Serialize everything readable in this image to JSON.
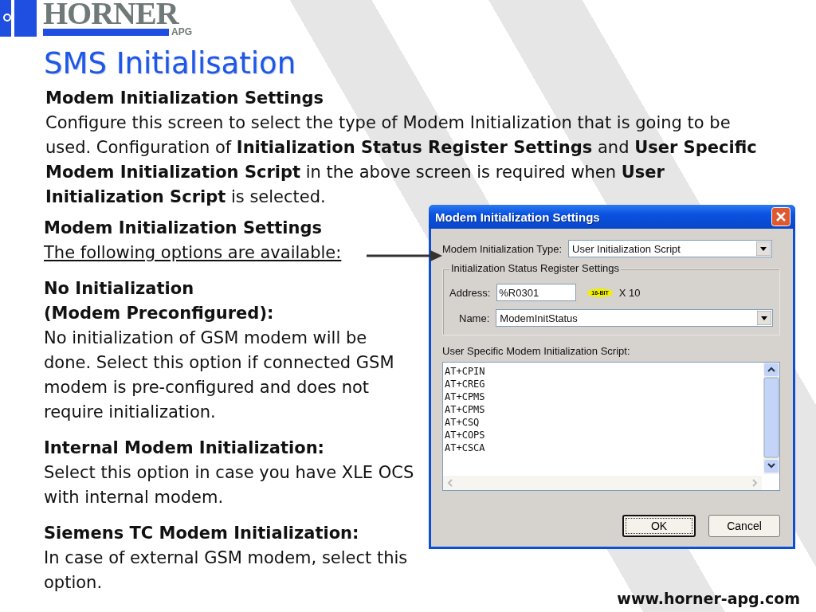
{
  "logo": {
    "name": "HORNER",
    "sub": "APG"
  },
  "title": "SMS Initialisation",
  "intro": {
    "heading": "Modem Initialization Settings",
    "text": "Configure this screen to select the type of Modem Initialization that is going to be used. Configuration of **Initialization Status Register Settings** and **User Specific Modem Initialization Script** in the above screen is required when **User Initialization Script** is selected."
  },
  "options_section": {
    "heading": "Modem Initialization Settings",
    "subheading": "The following options are available:",
    "options": [
      {
        "title_lines": [
          "No Initialization",
          "(Modem Preconfigured):"
        ],
        "description": "No initialization of GSM modem will be done. Select this option if connected GSM modem is pre-configured and does not require initialization."
      },
      {
        "title_lines": [
          "Internal Modem Initialization:"
        ],
        "description": "Select this option in case you have XLE OCS with internal modem."
      },
      {
        "title_lines": [
          "Siemens TC Modem Initialization:"
        ],
        "description": "In case of external GSM modem, select this option."
      }
    ]
  },
  "dialog": {
    "title": "Modem Initialization Settings",
    "type_label": "Modem Initialization Type:",
    "type_value": "User Initialization Script",
    "group": {
      "title": "Initialization Status Register Settings",
      "address_label": "Address:",
      "address_value": "%R0301",
      "badge": "16-BIT",
      "multiplier": "X 10",
      "name_label": "Name:",
      "name_value": "ModemInitStatus"
    },
    "script_label": "User Specific Modem Initialization Script:",
    "script_lines": [
      "AT+CPIN",
      "AT+CREG",
      "AT+CPMS",
      "AT+CPMS",
      "AT+CSQ",
      "AT+COPS",
      "AT+CSCA"
    ],
    "buttons": [
      {
        "label": "OK",
        "default": true
      },
      {
        "label": "Cancel",
        "default": false
      }
    ]
  },
  "footer": "www.horner-apg.com"
}
